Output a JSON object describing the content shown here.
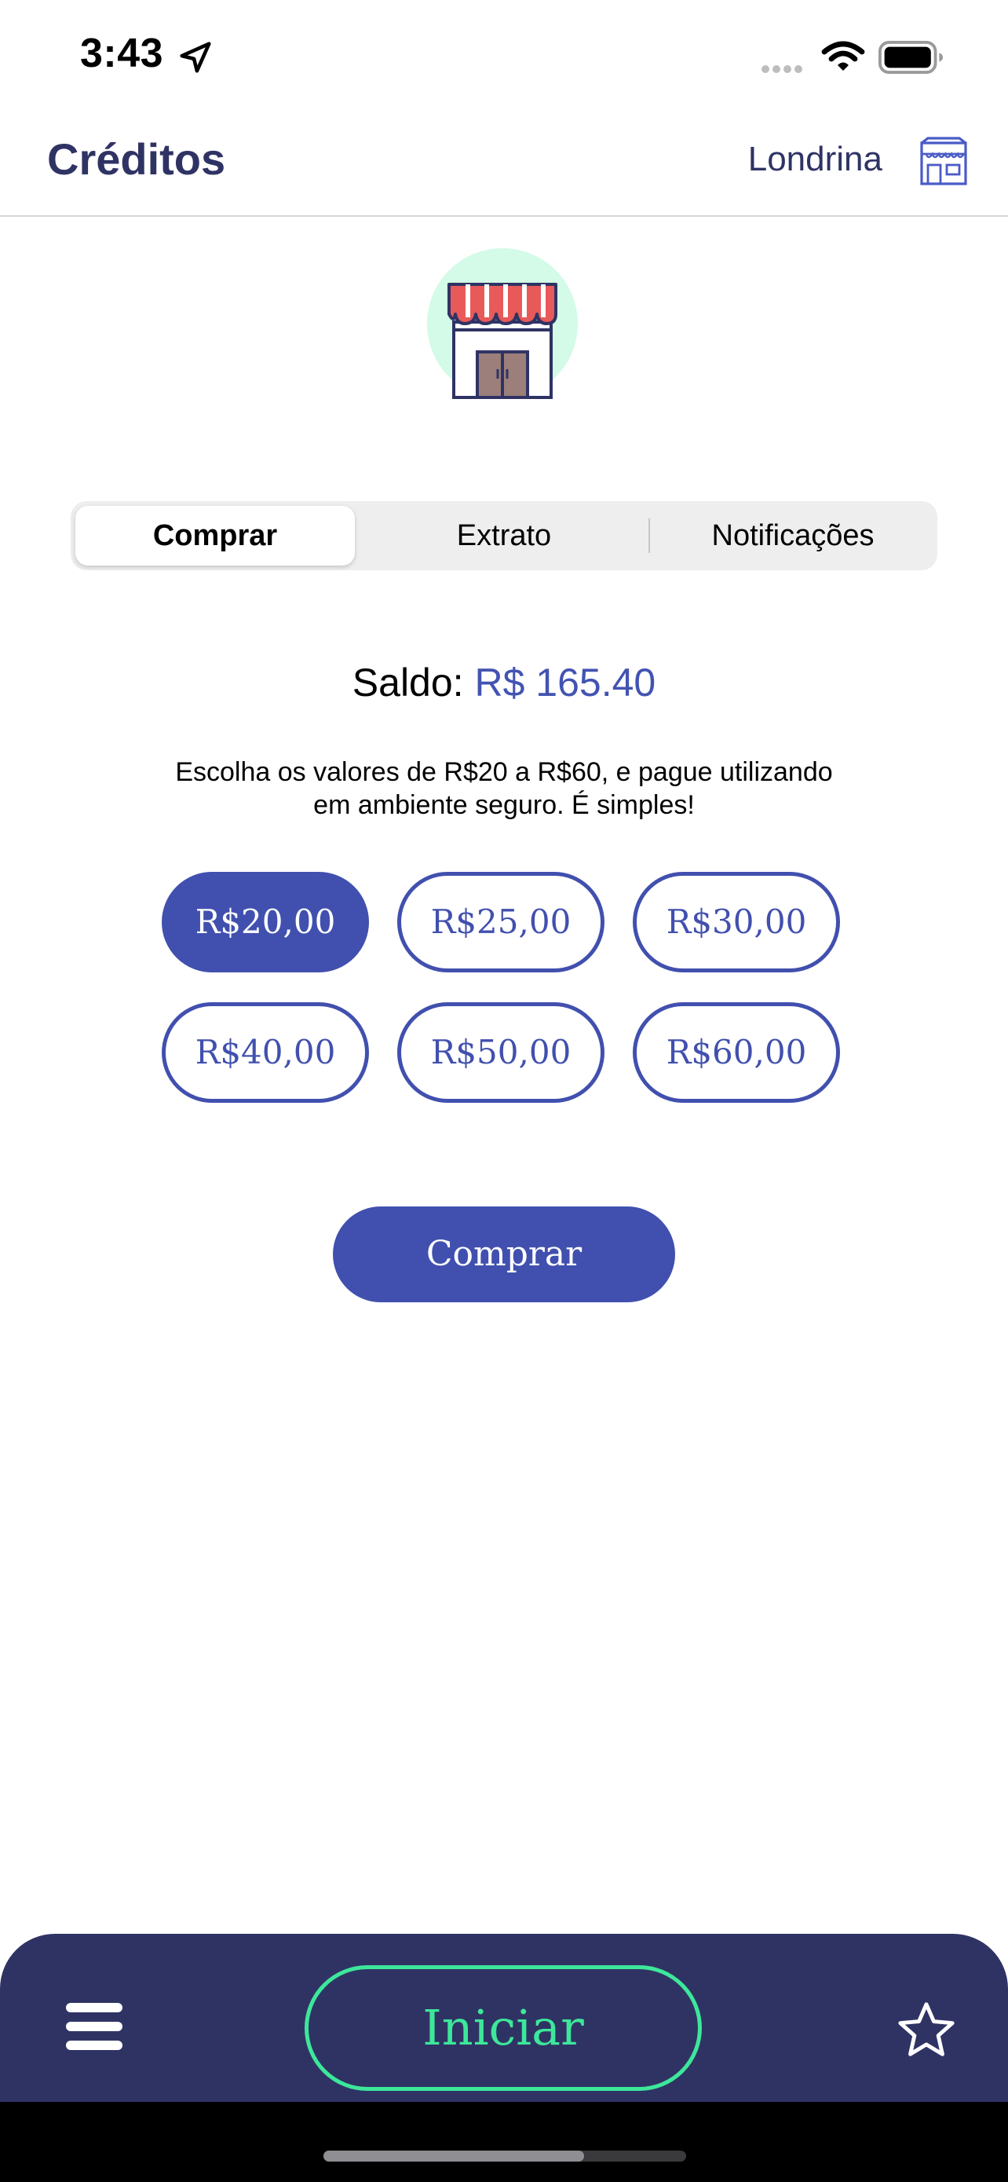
{
  "status_bar": {
    "time": "3:43",
    "icons": [
      "location-arrow-icon",
      "signal-icon",
      "wifi-icon",
      "battery-icon"
    ]
  },
  "header": {
    "title": "Créditos",
    "city": "Londrina",
    "city_icon": "store-outline-icon"
  },
  "illustration": {
    "icon": "storefront-icon"
  },
  "tabs": [
    {
      "label": "Comprar",
      "active": true
    },
    {
      "label": "Extrato",
      "active": false
    },
    {
      "label": "Notificações",
      "active": false
    }
  ],
  "balance": {
    "label": "Saldo:",
    "value": "R$ 165.40"
  },
  "description": {
    "line1": "Escolha os valores de R$20 a R$60, e pague utilizando",
    "line2": "em ambiente seguro. É simples!"
  },
  "amounts": [
    {
      "label": "R$20,00",
      "selected": true
    },
    {
      "label": "R$25,00",
      "selected": false
    },
    {
      "label": "R$30,00",
      "selected": false
    },
    {
      "label": "R$40,00",
      "selected": false
    },
    {
      "label": "R$50,00",
      "selected": false
    },
    {
      "label": "R$60,00",
      "selected": false
    }
  ],
  "buy_button": {
    "label": "Comprar"
  },
  "bottom_bar": {
    "menu_icon": "hamburger-menu-icon",
    "start_label": "Iniciar",
    "star_icon": "star-outline-icon"
  },
  "colors": {
    "primary": "#4150ae",
    "navy": "#2f3364",
    "accent_green": "#3de79a",
    "awning_red": "#e85a5a",
    "mint": "#d3fbe7"
  }
}
